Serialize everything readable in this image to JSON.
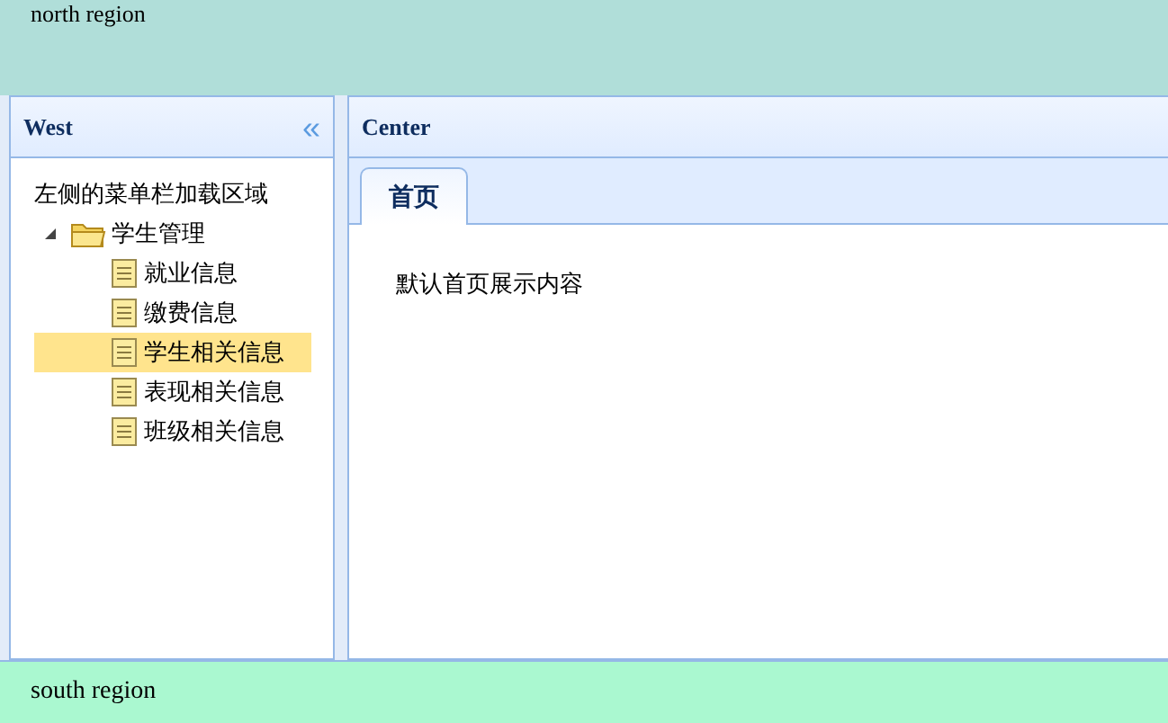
{
  "north": {
    "text": "north region"
  },
  "west": {
    "title": "West",
    "collapse_glyph": "«",
    "intro": "左侧的菜单栏加载区域",
    "tree": [
      {
        "label": "学生管理",
        "expanded": true,
        "selected": false,
        "children": [
          {
            "label": "就业信息",
            "selected": false
          },
          {
            "label": "缴费信息",
            "selected": false
          },
          {
            "label": "学生相关信息",
            "selected": true
          },
          {
            "label": "表现相关信息",
            "selected": false
          },
          {
            "label": "班级相关信息",
            "selected": false
          }
        ]
      }
    ]
  },
  "center": {
    "title": "Center",
    "tabs": [
      {
        "label": "首页",
        "selected": true
      }
    ],
    "content": "默认首页展示内容"
  },
  "south": {
    "text": "south region"
  }
}
